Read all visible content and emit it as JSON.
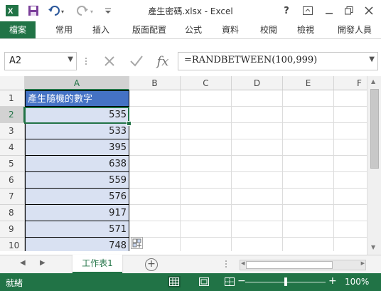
{
  "app": {
    "title": "產生密碼.xlsx - Excel"
  },
  "window": {
    "help": "?",
    "ribbon_display": "▭",
    "minimize": "—",
    "restore": "▭",
    "close": "✕"
  },
  "ribbon": {
    "file_tab": "檔案",
    "tabs": [
      "常用",
      "插入",
      "版面配置",
      "公式",
      "資料",
      "校閱",
      "檢視",
      "開發人員"
    ]
  },
  "formula_bar": {
    "name_box": "A2",
    "formula": "=RANDBETWEEN(100,999)",
    "fx_label": "fx"
  },
  "grid": {
    "columns": [
      "A",
      "B",
      "C",
      "D",
      "E",
      "F"
    ],
    "row_numbers": [
      "1",
      "2",
      "3",
      "4",
      "5",
      "6",
      "7",
      "8",
      "9",
      "10"
    ],
    "header_cell": "產生隨機的數字",
    "values": [
      "535",
      "533",
      "395",
      "638",
      "559",
      "576",
      "917",
      "571",
      "748"
    ]
  },
  "sheets": {
    "active": "工作表1",
    "add": "+"
  },
  "status": {
    "text": "就緒",
    "zoom": "100%",
    "zoom_minus": "−",
    "zoom_plus": "+"
  },
  "colors": {
    "accent": "#217346",
    "header_fill": "#4472c4",
    "data_fill": "#d9e1f2"
  }
}
